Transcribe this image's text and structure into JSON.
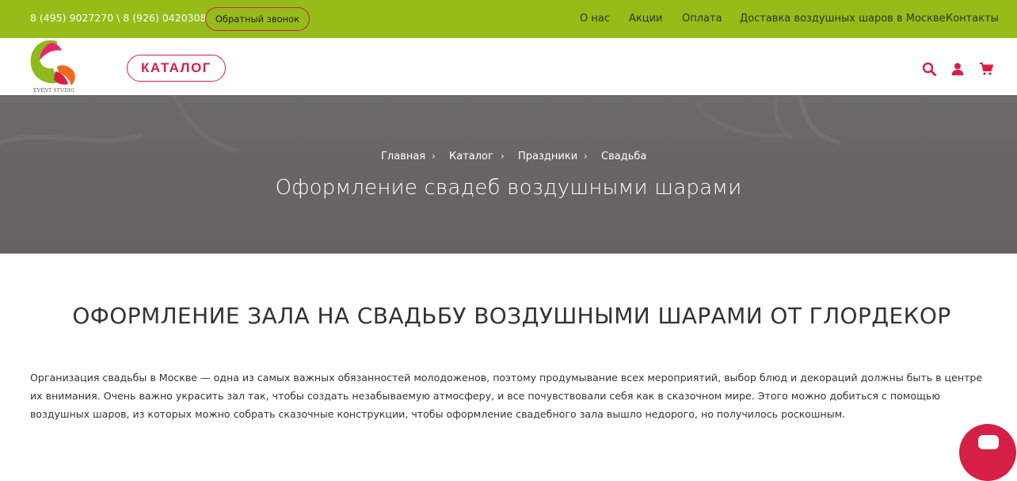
{
  "topbar": {
    "phones": "8 (495) 9027270 \\ 8 (926) 0420308",
    "callback_label": "Обратный звонок",
    "nav": [
      "О нас",
      "Акции",
      "Оплата",
      "Доставка воздушных шаров в Москве",
      "Контакты"
    ]
  },
  "header": {
    "logo_text": "EVENT STUDIO",
    "catalog_label": "КАТАЛОГ",
    "icons": [
      "search-icon",
      "user-icon",
      "cart-icon"
    ]
  },
  "hero": {
    "breadcrumbs": [
      "Главная",
      "Каталог",
      "Праздники",
      "Свадьба"
    ],
    "separator": "›",
    "title": "Оформление свадеб воздушными шарами"
  },
  "content": {
    "heading": "ОФОРМЛЕНИЕ ЗАЛА НА СВАДЬБУ ВОЗДУШНЫМИ ШАРАМИ ОТ ГЛОРДЕКОР",
    "paragraph": "Организация свадьбы в Москве — одна из самых важных обязанностей молодоженов, поэтому продумывание всех мероприятий, выбор блюд и декораций должны быть в центре их внимания. Очень важно украсить зал так, чтобы создать незабываемую атмосферу, и все почувствовали себя как в сказочном мире. Этого можно добиться с помощью воздушных шаров, из которых можно собрать сказочные конструкции, чтобы оформление свадебного зала вышло недорого, но получилось роскошным."
  },
  "colors": {
    "topbar_bg": "#95bc18",
    "accent": "#d61f45",
    "hero_bg": "#6a6563",
    "text": "#333333"
  }
}
